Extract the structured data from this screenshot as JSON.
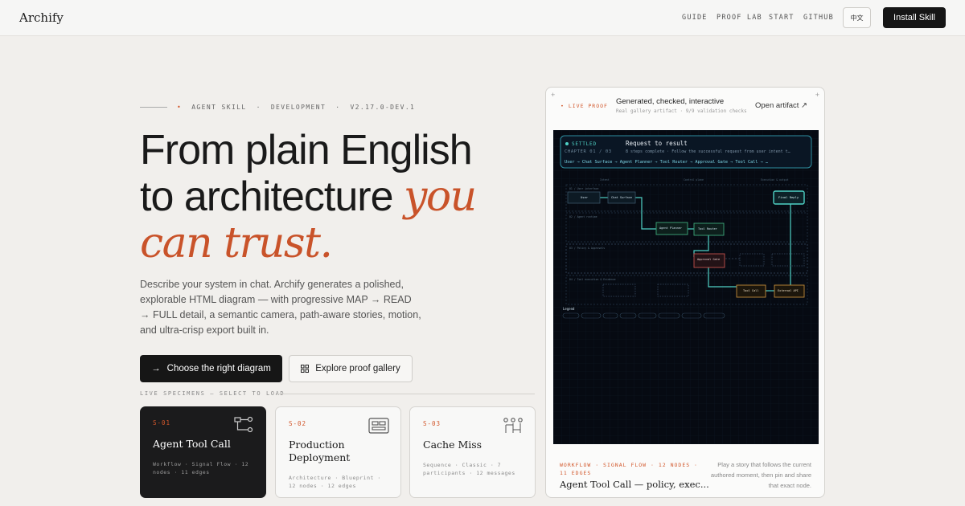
{
  "nav": {
    "logo": "Archify",
    "links": [
      "GUIDE",
      "PROOF LAB",
      "START",
      "GITHUB"
    ],
    "lang": "中文",
    "install": "Install Skill"
  },
  "hero": {
    "eyebrow": [
      "AGENT SKILL",
      "DEVELOPMENT",
      "V2.17.0-DEV.1"
    ],
    "eyebrow_sep": "·",
    "title_line1": "From plain English",
    "title_line2": "to architecture ",
    "title_accent1": "you",
    "title_accent2": "can trust.",
    "description": "Describe your system in chat. Archify generates a polished, explorable HTML diagram — with progressive MAP → READ → FULL detail, a semantic camera, path-aware stories, motion, and ultra-crisp export built in.",
    "primary_button": "Choose the right diagram",
    "secondary_button": "Explore proof gallery",
    "specimens_label": "LIVE SPECIMENS — SELECT TO LOAD"
  },
  "cards": [
    {
      "code": "S-01",
      "title": "Agent Tool Call",
      "meta": "Workflow · Signal Flow · 12 nodes · 11 edges",
      "icon": "workflow-icon"
    },
    {
      "code": "S-02",
      "title": "Production Deployment",
      "meta": "Architecture · Blueprint · 12 nodes · 12 edges",
      "icon": "blueprint-icon"
    },
    {
      "code": "S-03",
      "title": "Cache Miss",
      "meta": "Sequence · Classic · 7 participants · 12 messages",
      "icon": "sequence-icon"
    }
  ],
  "proof": {
    "live": "LIVE PROOF",
    "title": "Generated, checked, interactive",
    "subtitle": "Real gallery artifact · 9/9 validation checks",
    "open": "Open artifact ↗",
    "footer_meta": "WORKFLOW · SIGNAL FLOW · 12 NODES · 11 EDGES",
    "footer_title": "Agent Tool Call — policy, exec...",
    "footer_desc": "Play a story that follows the current authored moment, then pin and share that exact node."
  },
  "diagram": {
    "status": "SETTLED",
    "chapter": "CHAPTER 01 / 03",
    "story_title": "Request to result",
    "story_sub": "8 steps complete · Follow the successful request from user intent t…",
    "path": "User → Chat Surface → Agent Planner → Tool Router → Approval Gate → Tool Call → …",
    "lanes": [
      "Intent",
      "Control plane",
      "Execution & output"
    ],
    "bands": [
      "01 / User interface",
      "02 / Agent runtime",
      "03 / Policy & Approvals",
      "04 / Tool execution & Evidence"
    ],
    "nodes": [
      "User",
      "Chat Surface",
      "Agent Planner",
      "Tool Router",
      "Approval Gate",
      "Tool Call",
      "External API",
      "Final Reply"
    ],
    "legend": "Legend",
    "colors": {
      "accent": "#d2572b",
      "teal": "#4fd1c5",
      "green": "#3ea87a",
      "red": "#c0504d",
      "screen": "#060a12"
    }
  }
}
